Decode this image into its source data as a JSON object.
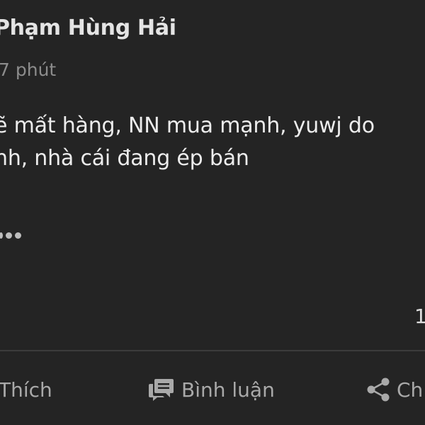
{
  "post": {
    "author": "Phạm Hùng Hải",
    "time": "7 phút",
    "lines": [
      "ẽ mất hàng, NN mua mạnh, yuwj do",
      "nh, nhà cái đang ép bán"
    ],
    "count": "1"
  },
  "actions": {
    "like": "Thích",
    "comment": "Bình luận",
    "share": "Ch"
  },
  "icons": {
    "more": "ellipsis-icon",
    "comment": "comment-icon",
    "share": "share-icon"
  },
  "colors": {
    "background": "#242424",
    "text": "#ececec",
    "muted": "#8c8c8c",
    "action": "#a9a9a9"
  }
}
